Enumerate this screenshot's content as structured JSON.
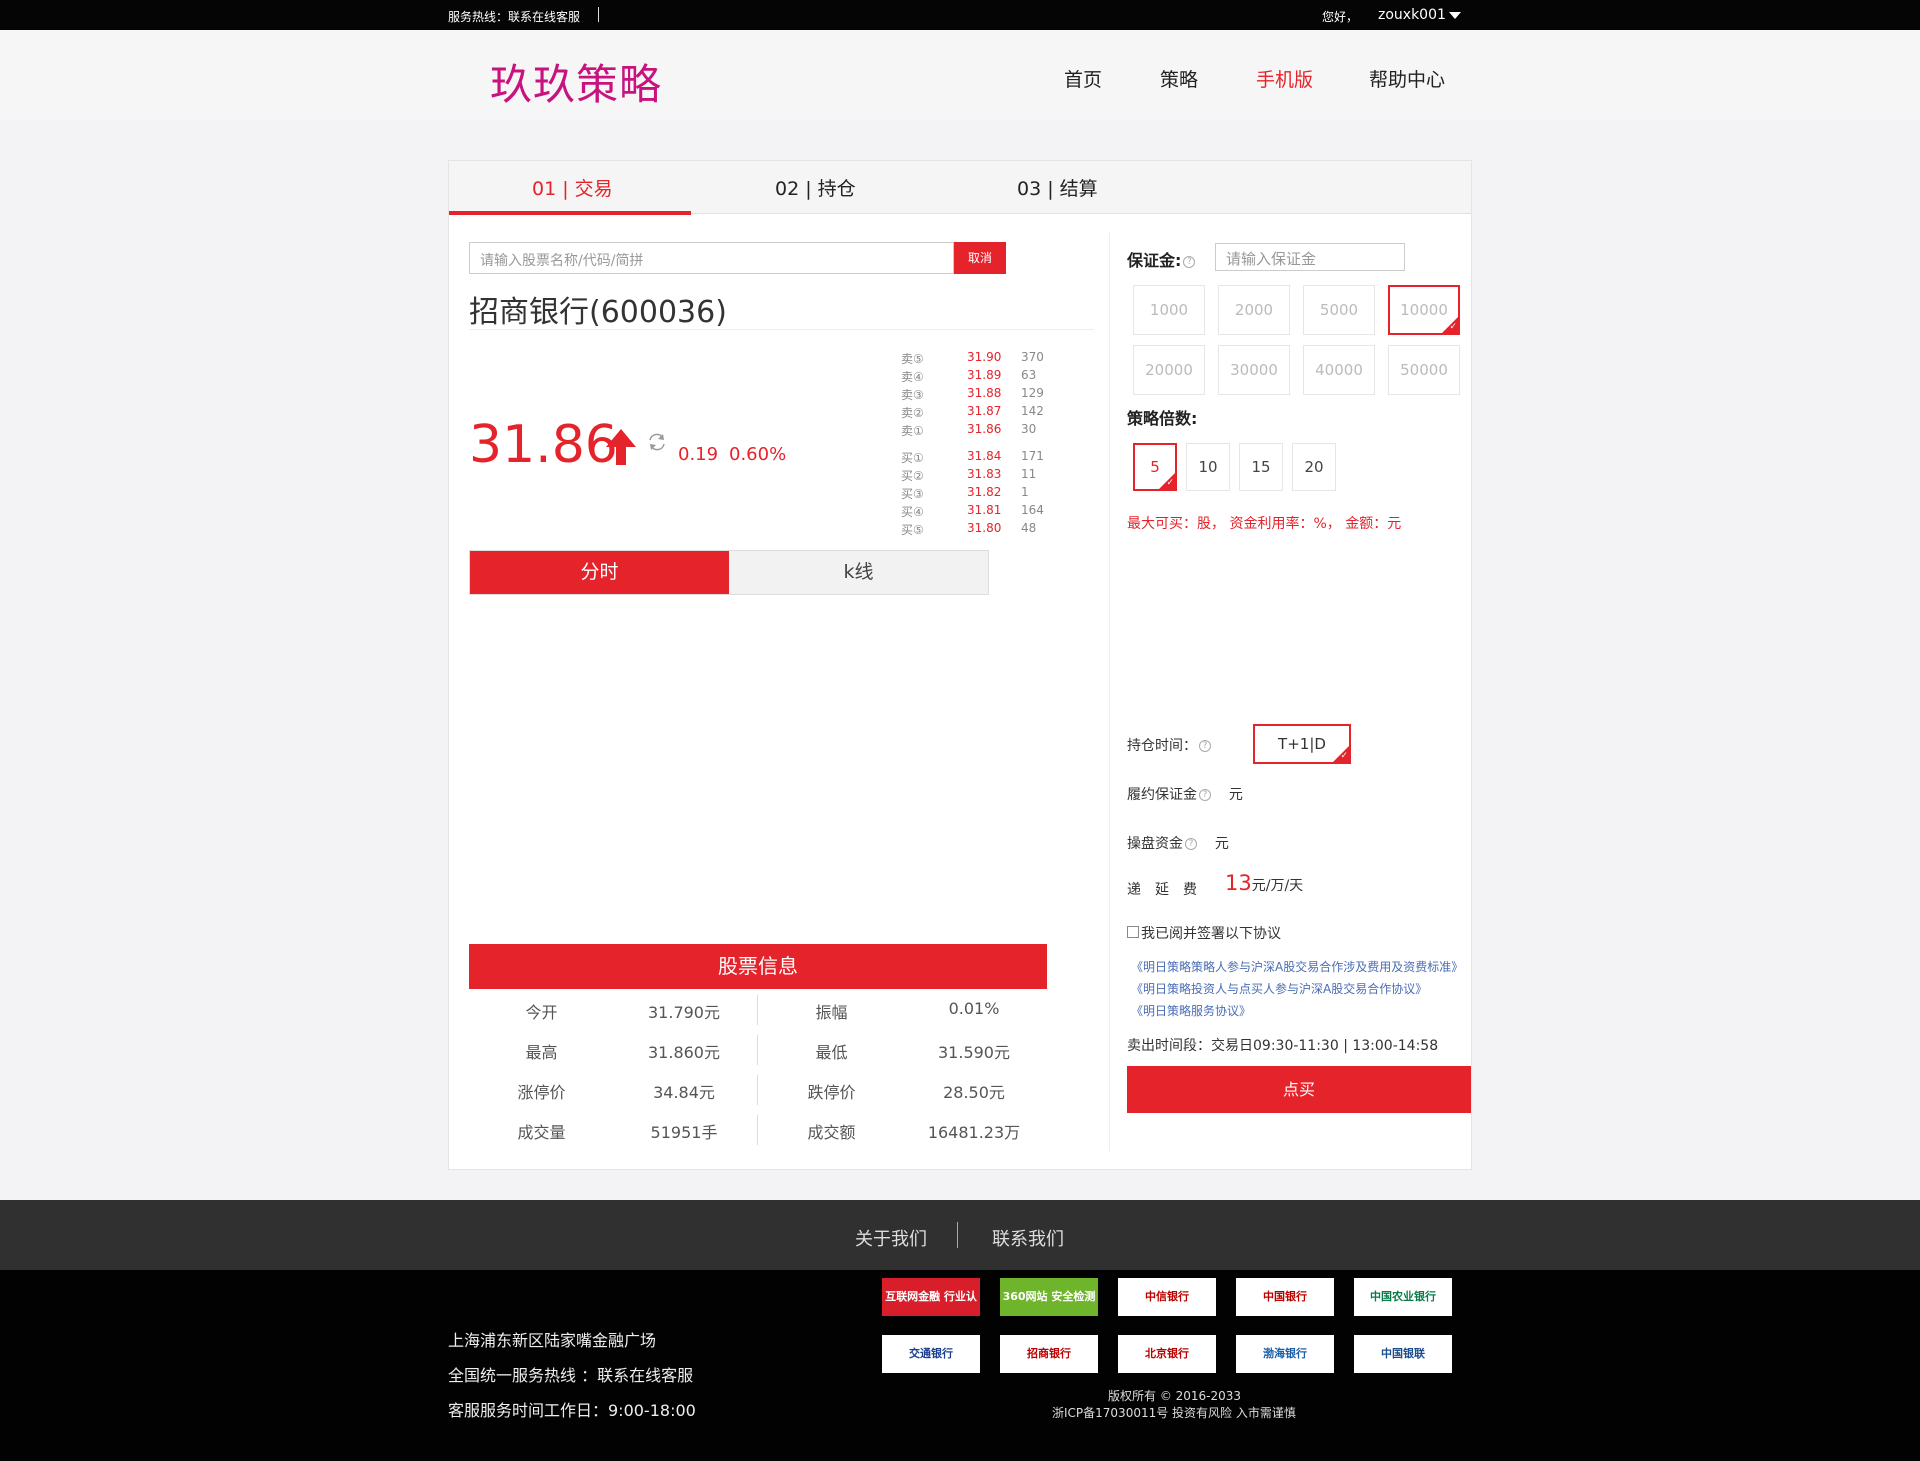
{
  "topbar": {
    "hotline": "服务热线：联系在线客服",
    "greeting": "您好，",
    "username": "zouxk001"
  },
  "header": {
    "logo": "玖玖策略",
    "nav": [
      "首页",
      "策略",
      "手机版",
      "帮助中心"
    ],
    "active_nav": "手机版"
  },
  "steps": [
    {
      "num": "01",
      "label": "交易"
    },
    {
      "num": "02",
      "label": "持仓"
    },
    {
      "num": "03",
      "label": "结算"
    }
  ],
  "search": {
    "placeholder": "请输入股票名称/代码/简拼",
    "cancel": "取消"
  },
  "stock": {
    "name": "招商银行(600036)",
    "price": "31.86",
    "change": "0.19",
    "change_pct": "0.60%"
  },
  "order_book": {
    "sell": [
      {
        "label": "卖⑤",
        "price": "31.90",
        "vol": "370"
      },
      {
        "label": "卖④",
        "price": "31.89",
        "vol": "63"
      },
      {
        "label": "卖③",
        "price": "31.88",
        "vol": "129"
      },
      {
        "label": "卖②",
        "price": "31.87",
        "vol": "142"
      },
      {
        "label": "卖①",
        "price": "31.86",
        "vol": "30"
      }
    ],
    "buy": [
      {
        "label": "买①",
        "price": "31.84",
        "vol": "171"
      },
      {
        "label": "买②",
        "price": "31.83",
        "vol": "11"
      },
      {
        "label": "买③",
        "price": "31.82",
        "vol": "1"
      },
      {
        "label": "买④",
        "price": "31.81",
        "vol": "164"
      },
      {
        "label": "买⑤",
        "price": "31.80",
        "vol": "48"
      }
    ]
  },
  "chart_tabs": [
    "分时",
    "k线"
  ],
  "info": {
    "title": "股票信息",
    "rows": [
      [
        "今开",
        "31.790元",
        "振幅",
        "0.01%"
      ],
      [
        "最高",
        "31.860元",
        "最低",
        "31.590元"
      ],
      [
        "涨停价",
        "34.84元",
        "跌停价",
        "28.50元"
      ],
      [
        "成交量",
        "51951手",
        "成交额",
        "16481.23万"
      ]
    ]
  },
  "right": {
    "margin_label": "保证金:",
    "margin_placeholder": "请输入保证金",
    "margin_options": [
      "1000",
      "2000",
      "5000",
      "10000",
      "20000",
      "30000",
      "40000",
      "50000"
    ],
    "margin_selected": "10000",
    "multiple_label": "策略倍数:",
    "multiples": [
      "5",
      "10",
      "15",
      "20"
    ],
    "multiple_selected": "5",
    "max_buy": "最大可买：股， 资金利用率：%， 金额：元",
    "hold_label": "持仓时间：",
    "hold_value": "T+1|D",
    "perf_margin_label": "履约保证金",
    "perf_margin_unit": "元",
    "trade_fund_label": "操盘资金",
    "trade_fund_unit": "元",
    "defer_label": "递　延　费",
    "defer_value": "13",
    "defer_unit": "元/万/天",
    "agree_text": "我已阅并签署以下协议",
    "links": [
      "《明日策略策略人参与沪深A股交易合作涉及费用及资费标准》",
      "《明日策略投资人与点买人参与沪深A股交易合作协议》",
      "《明日策略服务协议》"
    ],
    "sell_time": "卖出时间段：交易日09:30-11:30 | 13:00-14:58",
    "buy_button": "点买"
  },
  "footer": {
    "nav": [
      "关于我们",
      "联系我们"
    ],
    "address": "上海浦东新区陆家嘴金融广场",
    "hotline": "全国统一服务热线 ：联系在线客服",
    "hours": "客服服务时间工作日：9:00-18:00",
    "badges_row1": [
      "互联网金融 行业认证",
      "360网站 安全检测",
      "中信银行",
      "中国银行",
      "中国农业银行"
    ],
    "badges_row2": [
      "交通银行",
      "招商银行",
      "北京银行",
      "渤海银行",
      "中国银联"
    ],
    "copyright": "版权所有 © 2016-2033",
    "icp": "浙ICP备17030011号 投资有风险 入市需谨慎"
  }
}
